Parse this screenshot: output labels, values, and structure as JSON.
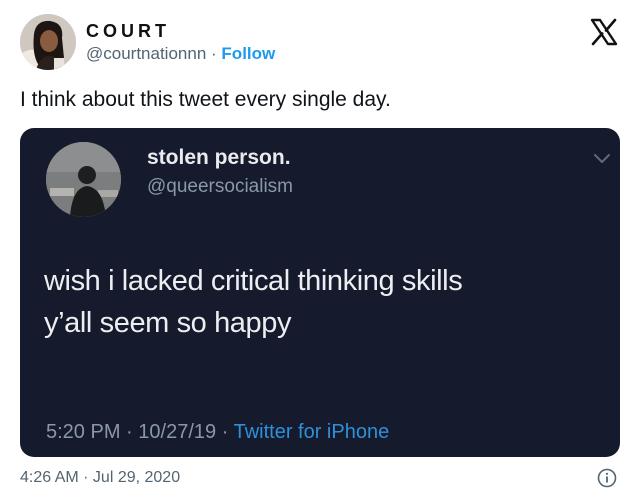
{
  "author": {
    "display_name": "COURT",
    "handle": "@courtnationnn",
    "separator": "·",
    "follow_label": "Follow"
  },
  "tweet": {
    "text": "I think about this tweet every single day.",
    "timestamp": "4:26 AM · Jul 29, 2020"
  },
  "embedded_tweet": {
    "display_name": "stolen person.",
    "handle": "@queersocialism",
    "body_lines": [
      "wish i lacked critical thinking skills",
      "y’all seem so happy"
    ],
    "time": "5:20 PM",
    "date": "10/27/19",
    "separator": "·",
    "source": "Twitter for iPhone"
  },
  "icons": {
    "brand": "x-logo-icon",
    "menu": "chevron-down-icon",
    "info": "info-icon"
  },
  "colors": {
    "accent": "#1d9bf0",
    "embed_background": "#151b2c",
    "embed_link": "#2f8fd8",
    "muted_text": "#536471"
  }
}
